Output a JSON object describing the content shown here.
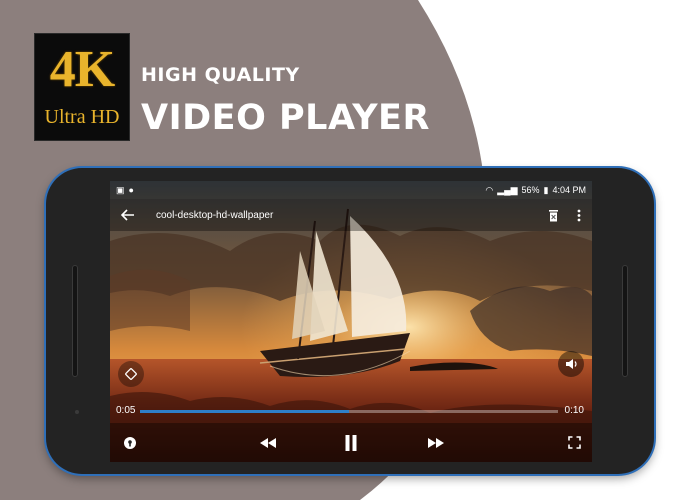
{
  "promo": {
    "logo_big": "4K",
    "logo_small": "Ultra HD",
    "headline_1": "HIGH QUALITY",
    "headline_2": "VIDEO PLAYER"
  },
  "colors": {
    "background_shape": "#8c7f7d",
    "accent_blue": "#2f7fc8",
    "logo_gold": "#e9b42c"
  },
  "status_bar": {
    "battery": "56%",
    "time": "4:04 PM",
    "left_icons": [
      "image-notification-icon",
      "phone-notification-icon"
    ],
    "right_icons": [
      "wifi-icon",
      "signal-icon",
      "battery-icon"
    ]
  },
  "player": {
    "title": "cool-desktop-hd-wallpaper",
    "current_time": "0:05",
    "total_time": "0:10",
    "progress": 0.5,
    "buttons": {
      "back": "arrow-back-icon",
      "delete": "delete-icon",
      "more": "more-vert-icon",
      "rotate": "screen-rotation-icon",
      "volume": "volume-icon",
      "lock": "lock-icon",
      "rewind": "rewind-icon",
      "pause": "pause-icon",
      "forward": "fast-forward-icon",
      "fullscreen": "fullscreen-icon"
    }
  }
}
